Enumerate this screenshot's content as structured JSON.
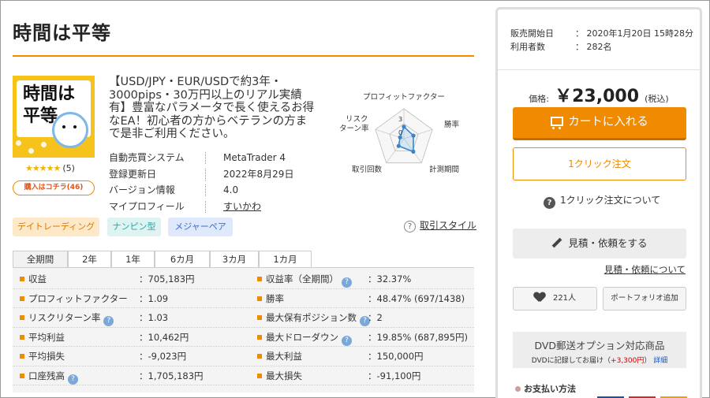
{
  "product": {
    "title": "時間は平等",
    "image_text": "時間は平等",
    "rating_stars": "★★★★★",
    "rating_count": "(5)",
    "buyer_badge": "購入はコチラ(46)",
    "description": "【USD/JPY・EUR/USDで約3年・3000pips・30万円以上のリアル実績有】豊富なパラメータで長く使えるお得なEA！初心者の方からベテランの方まで是非ご利用ください。"
  },
  "specs": [
    {
      "label": "自動売買システム",
      "value": "MetaTrader 4"
    },
    {
      "label": "登録更新日",
      "value": "2022年8月29日"
    },
    {
      "label": "バージョン情報",
      "value": "4.0"
    },
    {
      "label": "マイプロフィール",
      "value": "すいかわ"
    }
  ],
  "radar": {
    "axes": [
      "プロフィットファクター",
      "勝率",
      "計測期間",
      "取引回数",
      "リスク",
      "ターン率"
    ],
    "scale_labels": [
      "3",
      "0"
    ],
    "values": [
      1.2,
      1.0,
      1.6,
      0.9,
      0.4
    ],
    "max": 3
  },
  "tags": [
    "デイトレーディング",
    "ナンピン型",
    "メジャーペア"
  ],
  "style_help": "取引スタイル",
  "period_tabs": [
    "全期間",
    "2年",
    "1年",
    "6カ月",
    "3カ月",
    "1カ月"
  ],
  "stats_left": [
    {
      "label": "収益",
      "value": "：705,183円",
      "info": false
    },
    {
      "label": "プロフィットファクター",
      "value": "：1.09",
      "info": false
    },
    {
      "label": "リスクリターン率",
      "value": "：1.03",
      "info": true
    },
    {
      "label": "平均利益",
      "value": "：10,462円",
      "info": false
    },
    {
      "label": "平均損失",
      "value": "：-9,023円",
      "info": false
    },
    {
      "label": "口座残高",
      "value": "：1,705,183円",
      "info": true
    }
  ],
  "stats_right": [
    {
      "label": "収益率（全期間）",
      "value": "：32.37%",
      "info": true
    },
    {
      "label": "勝率",
      "value": "：48.47% (697/1438)",
      "info": false
    },
    {
      "label": "最大保有ポジション数",
      "value": "：2",
      "info": true
    },
    {
      "label": "最大ドローダウン",
      "value": "：19.85% (687,895円)",
      "info": true
    },
    {
      "label": "最大利益",
      "value": "：150,000円",
      "info": false
    },
    {
      "label": "最大損失",
      "value": "：-91,100円",
      "info": false
    }
  ],
  "sale": {
    "start_label": "販売開始日",
    "start_value": "： 2020年1月20日 15時28分",
    "users_label": "利用者数",
    "users_value": "： 282名",
    "price_label": "価格:",
    "price_value": "￥23,000",
    "tax_label": "(税込)",
    "cart_button": "カートに入れる",
    "one_click_button": "1クリック注文",
    "one_click_help": "1クリック注文について",
    "quote_button": "見積・依頼をする",
    "quote_link": "見積・依頼について",
    "favorite_count": "221人",
    "portfolio_button": "ポートフォリオ追加",
    "dvd_title": "DVD郵送オプション対応商品",
    "dvd_sub_pre": "DVDに記録してお届け（",
    "dvd_sub_price": "+3,300円",
    "dvd_sub_post": "）",
    "dvd_detail": "詳細",
    "payment_title": "お支払い方法"
  },
  "colors": {
    "accent": "#f08a00",
    "radar_line": "#3a84c8",
    "info_icon": "#7aa8d8"
  }
}
